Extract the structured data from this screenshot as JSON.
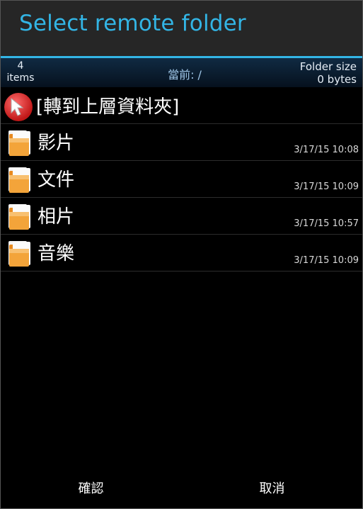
{
  "dialog": {
    "title": "Select remote folder"
  },
  "info": {
    "count": "4",
    "count_unit": "items",
    "current_path": "當前: /",
    "folder_size_label": "Folder size",
    "folder_size_value": "0 bytes"
  },
  "up_item": {
    "label": "[轉到上層資料夾]",
    "icon": "up-arrow-icon"
  },
  "items": [
    {
      "name": "影片",
      "date": "3/17/15 10:08",
      "icon": "folder-icon"
    },
    {
      "name": "文件",
      "date": "3/17/15 10:09",
      "icon": "folder-icon"
    },
    {
      "name": "相片",
      "date": "3/17/15 10:57",
      "icon": "folder-icon"
    },
    {
      "name": "音樂",
      "date": "3/17/15 10:09",
      "icon": "folder-icon"
    }
  ],
  "buttons": {
    "confirm": "確認",
    "cancel": "取消"
  },
  "colors": {
    "accent": "#33b5e5",
    "background": "#000000",
    "titlebar": "#262626",
    "folder": "#f0a030"
  }
}
